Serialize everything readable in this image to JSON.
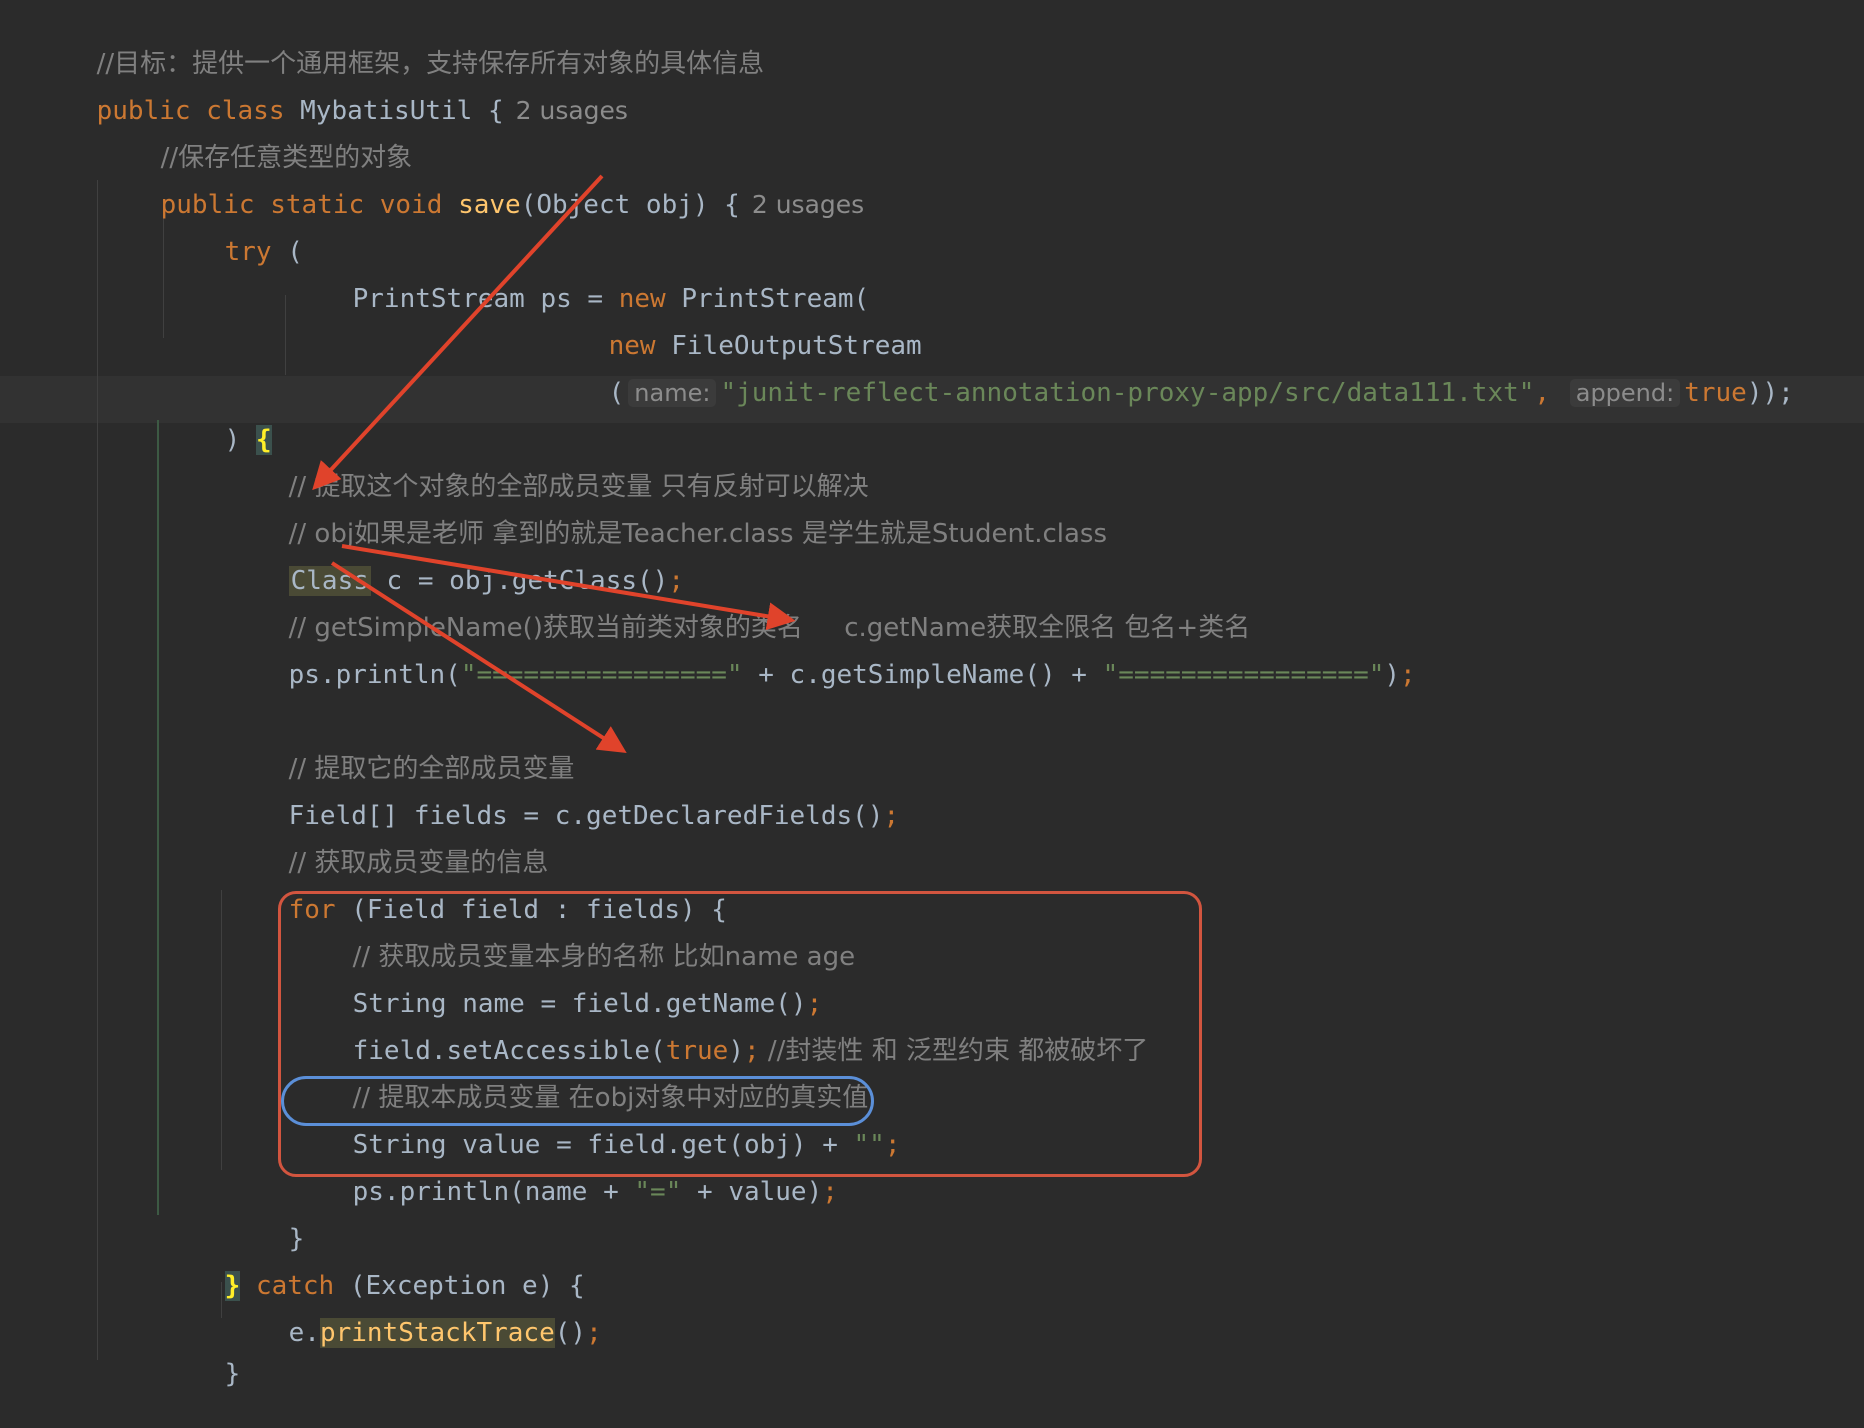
{
  "code": {
    "l1_comment": "//目标：提供一个通用框架，支持保存所有对象的具体信息",
    "l2_public": "public",
    "l2_class": "class",
    "l2_name": "MybatisUtil {",
    "l2_usages": "2 usages",
    "l3_comment": "//保存任意类型的对象",
    "l4_public": "public",
    "l4_static": "static",
    "l4_void": "void",
    "l4_method": "save",
    "l4_rest": "(Object obj) {",
    "l4_usages": "2 usages",
    "l5_try": "try",
    "l5_paren": " (",
    "l6_code": "PrintStream ps = ",
    "l6_new": "new",
    "l6_rest": " PrintStream(",
    "l7_new": "new",
    "l7_rest": " FileOutputStream",
    "l8_open": "(",
    "l8_hint_name": "name:",
    "l8_str": "\"junit-reflect-annotation-proxy-app/src/data111.txt\"",
    "l8_comma": ",",
    "l8_hint_append": "append:",
    "l8_true": "true",
    "l8_close": "));",
    "l9_paren": ") ",
    "l9_brace": "{",
    "l10_comment": "// 提取这个对象的全部成员变量 只有反射可以解决",
    "l11_comment": "// obj如果是老师 拿到的就是Teacher.class 是学生就是Student.class",
    "l12_class": "Class",
    "l12_rest": " c = obj.getClass()",
    "l12_semi": ";",
    "l13_comment": "// getSimpleName()获取当前类对象的类名     c.getName获取全限名 包名+类名",
    "l14_a": "ps.println(",
    "l14_s1": "\"================\"",
    "l14_b": " + c.getSimpleName() + ",
    "l14_s2": "\"================\"",
    "l14_c": ")",
    "l14_semi": ";",
    "l16_comment": "// 提取它的全部成员变量",
    "l17_code": "Field[] fields = c.getDeclaredFields()",
    "l17_semi": ";",
    "l18_comment": "// 获取成员变量的信息",
    "l19_for": "for",
    "l19_rest": " (Field field : fields) {",
    "l20_comment": "// 获取成员变量本身的名称 比如name age",
    "l21_code": "String name = field.getName()",
    "l21_semi": ";",
    "l22_code": "field.setAccessible(",
    "l22_true": "true",
    "l22_close": ")",
    "l22_semi": ";",
    "l22_comment": " //封装性 和 泛型约束 都被破坏了",
    "l23_comment": "// 提取本成员变量 在obj对象中对应的真实值",
    "l24_code": "String value = field.get(obj) + ",
    "l24_str": "\"\"",
    "l24_semi": ";",
    "l25_code": "ps.println(name + ",
    "l25_str": "\"=\"",
    "l25_rest": " + value)",
    "l25_semi": ";",
    "l26_brace": "}",
    "l27_brace": "}",
    "l27_catch": "catch",
    "l27_rest": " (Exception e) {",
    "l28_a": "e.",
    "l28_method": "printStackTrace",
    "l28_b": "()",
    "l28_semi": ";",
    "l29_brace": "}"
  },
  "colors": {
    "background": "#2b2b2b",
    "keyword": "#cc7832",
    "string": "#6a8759",
    "comment": "#808080",
    "method": "#ffc66d",
    "text": "#a9b7c6",
    "annotation_red": "#d2553f",
    "annotation_blue": "#5b8fd8"
  }
}
